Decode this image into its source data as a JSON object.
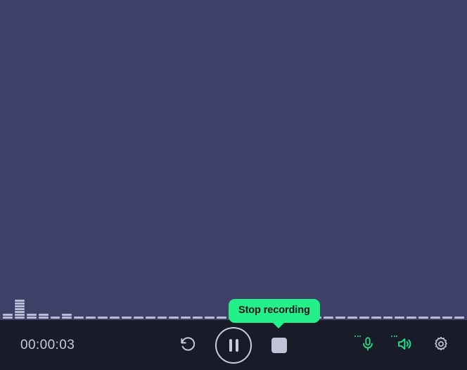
{
  "app": {
    "background_color": "#3e4068",
    "toolbar_color": "#191b28",
    "accent_color": "#24f08a",
    "control_color": "#c9ccdf"
  },
  "stage": {
    "name": "recording-preview"
  },
  "waveform": {
    "label": "audio-level-waveform",
    "segment_color": "#b9bcd6",
    "bars": [
      2,
      7,
      2,
      2,
      1,
      2,
      1,
      1,
      1,
      1,
      1,
      1,
      1,
      1,
      1,
      1,
      1,
      1,
      1,
      1,
      1,
      1,
      1,
      1,
      1,
      1,
      1,
      1,
      1,
      1,
      1,
      1,
      1,
      1,
      1,
      1,
      1,
      1,
      1
    ]
  },
  "toolbar": {
    "timer": "00:00:03",
    "restart_label": "Restart recording",
    "pause_label": "Pause recording",
    "stop_label": "Stop recording",
    "microphone_label": "Microphone",
    "speaker_label": "System sound",
    "settings_label": "Settings"
  },
  "tooltip": {
    "text": "Stop recording",
    "background_color": "#24f08a",
    "text_color": "#0e1020"
  },
  "icons": {
    "restart": "restart-icon",
    "pause": "pause-icon",
    "stop": "stop-icon",
    "microphone": "microphone-icon",
    "speaker": "speaker-icon",
    "gear": "gear-icon"
  }
}
